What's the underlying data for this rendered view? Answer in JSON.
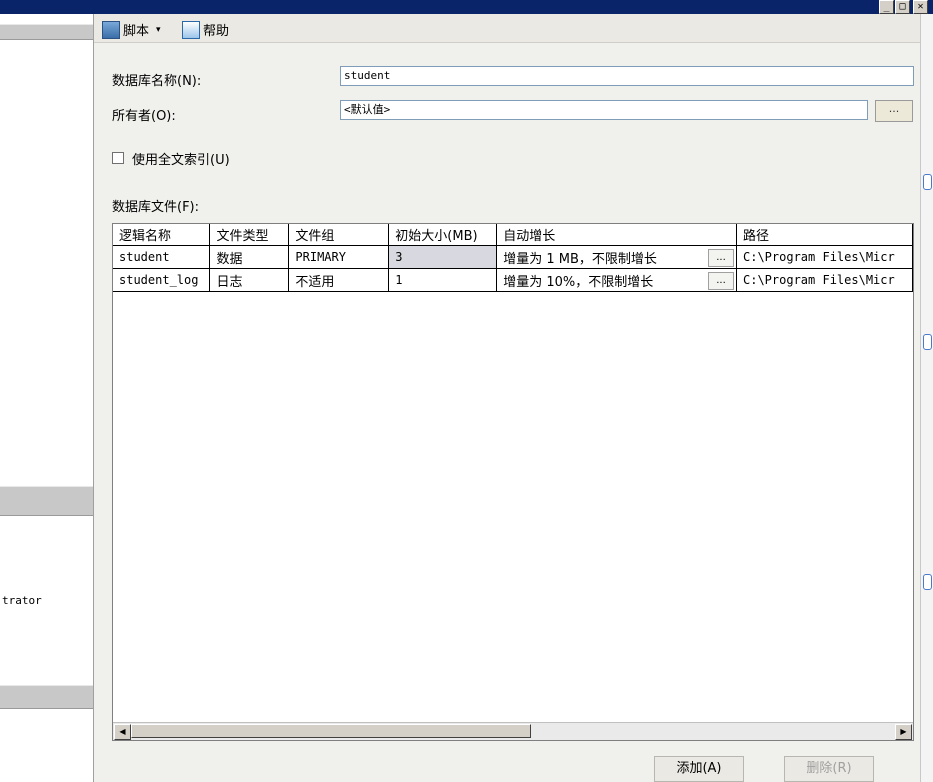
{
  "window": {
    "min_glyph": "_",
    "max_glyph": "□",
    "close_glyph": "✕"
  },
  "left_panel": {
    "user_fragment": "trator"
  },
  "toolbar": {
    "script_label": "脚本",
    "script_caret": "▾",
    "help_label": "帮助"
  },
  "form": {
    "db_name_label": "数据库名称(N):",
    "db_name_value": "student",
    "owner_label": "所有者(O):",
    "owner_value": "<默认值>",
    "owner_browse": "...",
    "fulltext_label": "使用全文索引(U)",
    "fulltext_checked": false,
    "files_label": "数据库文件(F):"
  },
  "grid": {
    "columns": [
      "逻辑名称",
      "文件类型",
      "文件组",
      "初始大小(MB)",
      "自动增长",
      "路径"
    ],
    "rows": [
      {
        "name": "student",
        "type": "数据",
        "group": "PRIMARY",
        "size": "3",
        "growth": "增量为 1 MB，不限制增长",
        "growth_btn": "...",
        "path": "C:\\Program Files\\Micr"
      },
      {
        "name": "student_log",
        "type": "日志",
        "group": "不适用",
        "size": "1",
        "growth": "增量为 10%，不限制增长",
        "growth_btn": "...",
        "path": "C:\\Program Files\\Micr"
      }
    ],
    "scroll_left": "◀",
    "scroll_right": "▶"
  },
  "buttons": {
    "add": "添加(A)",
    "remove": "删除(R)"
  }
}
